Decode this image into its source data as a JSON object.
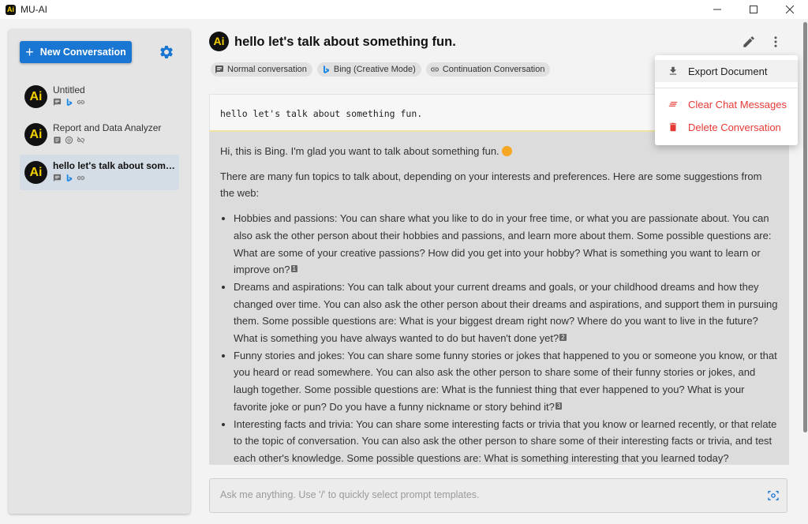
{
  "window": {
    "title": "MU-AI",
    "logo_text": "Ai",
    "controls": [
      "minimize",
      "maximize",
      "close"
    ]
  },
  "sidebar": {
    "new_button_label": "New Conversation",
    "conversations": [
      {
        "title": "Untitled",
        "avatar": "Ai",
        "icons": [
          "chat-icon",
          "bing-icon",
          "link-icon"
        ],
        "active": false
      },
      {
        "title": "Report and Data Analyzer",
        "avatar": "Ai",
        "icons": [
          "document-icon",
          "openai-icon",
          "link-off-icon"
        ],
        "active": false
      },
      {
        "title": "hello let's talk about something fun.",
        "avatar": "Ai",
        "icons": [
          "chat-icon",
          "bing-icon",
          "link-icon"
        ],
        "active": true
      }
    ]
  },
  "header": {
    "avatar": "Ai",
    "title": "hello let's talk about something fun.",
    "chips": [
      {
        "icon": "chat-icon",
        "label": "Normal conversation"
      },
      {
        "icon": "bing-icon",
        "label": "Bing (Creative Mode)"
      },
      {
        "icon": "link-icon",
        "label": "Continuation Conversation"
      }
    ]
  },
  "menu": {
    "export": "Export Document",
    "clear": "Clear Chat Messages",
    "delete": "Delete Conversation",
    "danger_color": "#e53935"
  },
  "chat": {
    "user_message": "hello let's talk about something fun.",
    "bot_intro": "Hi, this is Bing. I'm glad you want to talk about something fun.",
    "bot_para": "There are many fun topics to talk about, depending on your interests and preferences. Here are some suggestions from the web:",
    "bullets": [
      {
        "text": "Hobbies and passions: You can share what you like to do in your free time, or what you are passionate about. You can also ask the other person about their hobbies and passions, and learn more about them. Some possible questions are: What are some of your creative passions? How did you get into your hobby? What is something you want to learn or improve on?",
        "cite": "1"
      },
      {
        "text": "Dreams and aspirations: You can talk about your current dreams and goals, or your childhood dreams and how they changed over time. You can also ask the other person about their dreams and aspirations, and support them in pursuing them. Some possible questions are: What is your biggest dream right now? Where do you want to live in the future? What is something you have always wanted to do but haven't done yet?",
        "cite": "2"
      },
      {
        "text": "Funny stories and jokes: You can share some funny stories or jokes that happened to you or someone you know, or that you heard or read somewhere. You can also ask the other person to share some of their funny stories or jokes, and laugh together. Some possible questions are: What is the funniest thing that ever happened to you? What is your favorite joke or pun? Do you have a funny nickname or story behind it?",
        "cite": "3"
      },
      {
        "text": "Interesting facts and trivia: You can share some interesting facts or trivia that you know or learned recently, or that relate to the topic of conversation. You can also ask the other person to share some of their interesting facts or trivia, and test each other's knowledge. Some possible questions are: What is something interesting that you learned today?",
        "cite": ""
      }
    ]
  },
  "input": {
    "placeholder": "Ask me anything. Use '/' to quickly select prompt templates.",
    "value": ""
  },
  "colors": {
    "accent": "#1976d2",
    "logo_bg": "#111111",
    "logo_fg": "#f5d000"
  }
}
